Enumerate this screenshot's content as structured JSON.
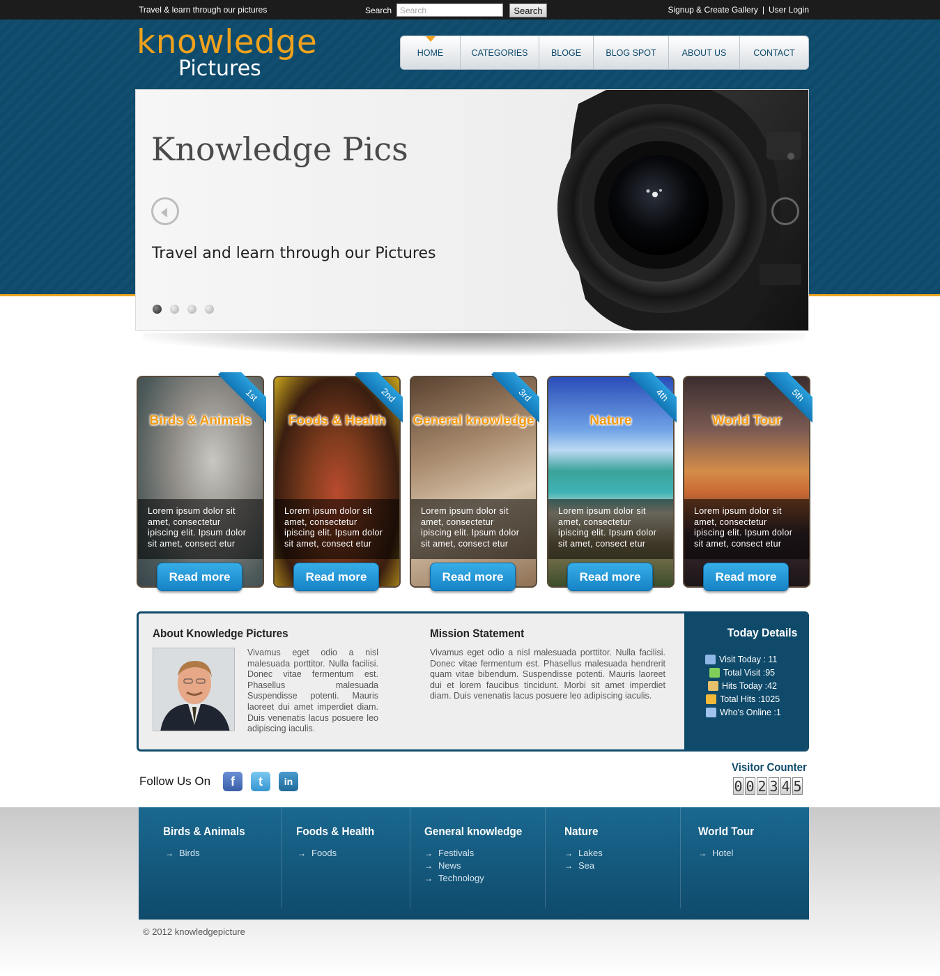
{
  "topbar": {
    "tagline": "Travel & learn through our pictures",
    "search_label": "Search",
    "search_placeholder": "Search",
    "search_button": "Search",
    "signup": "Signup & Create Gallery",
    "separator": "|",
    "login": "User Login"
  },
  "logo": {
    "line1": "knowledge",
    "line2": "Pictures"
  },
  "nav": {
    "items": [
      {
        "label": "HOME"
      },
      {
        "label": "CATEGORIES"
      },
      {
        "label": "BLOGE"
      },
      {
        "label": "BLOG SPOT"
      },
      {
        "label": "ABOUT US"
      },
      {
        "label": "CONTACT"
      }
    ],
    "active_index": 0
  },
  "slider": {
    "title": "Knowledge Pics",
    "subtitle": "Travel and learn through our Pictures",
    "slide_count": 4,
    "active_slide": 1
  },
  "cards": [
    {
      "rank": "1st",
      "title": "Birds & Animals",
      "text": "Lorem ipsum dolor sit amet, consectetur ipiscing elit. Ipsum dolor sit amet, consect etur",
      "button": "Read more"
    },
    {
      "rank": "2nd",
      "title": "Foods & Health",
      "text": "Lorem ipsum dolor sit amet, consectetur ipiscing elit. Ipsum dolor sit amet, consect etur",
      "button": "Read more"
    },
    {
      "rank": "3rd",
      "title": "General knowledge",
      "text": "Lorem ipsum dolor sit amet, consectetur ipiscing elit. Ipsum dolor sit amet, consect etur",
      "button": "Read more"
    },
    {
      "rank": "4th",
      "title": "Nature",
      "text": "Lorem ipsum dolor sit amet, consectetur ipiscing elit. Ipsum dolor sit amet, consect etur",
      "button": "Read more"
    },
    {
      "rank": "5th",
      "title": "World Tour",
      "text": "Lorem ipsum dolor sit amet, consectetur ipiscing elit. Ipsum dolor sit amet, consect etur",
      "button": "Read more"
    }
  ],
  "about": {
    "heading": "About Knowledge Pictures",
    "text": "Vivamus eget odio a nisl malesuada porttitor. Nulla facilisi. Donec vitae fermentum est. Phasellus malesuada Suspendisse potenti. Mauris laoreet dui amet imperdiet diam. Duis venenatis lacus posuere leo adipiscing iaculis."
  },
  "mission": {
    "heading": "Mission Statement",
    "text": "Vivamus eget odio a nisl malesuada porttitor. Nulla facilisi. Donec vitae fermentum est. Phasellus malesuada hendrerit quam vitae bibendum. Suspendisse potenti. Mauris laoreet dui et lorem faucibus tincidunt. Morbi sit amet imperdiet diam. Duis venenatis lacus posuere leo adipiscing iaculis."
  },
  "today": {
    "heading": "Today Details",
    "stats": [
      {
        "label": "Visit Today : 11",
        "icon": "users-icon",
        "color": "#8fb7e6"
      },
      {
        "label": "Total Visit :95",
        "icon": "mail-icon",
        "color": "#7fcf5a"
      },
      {
        "label": "Hits Today :42",
        "icon": "user-icon",
        "color": "#e6c06a"
      },
      {
        "label": "Total Hits :1025",
        "icon": "chart-icon",
        "color": "#f0b93a"
      },
      {
        "label": "Who's Online :1",
        "icon": "online-user-icon",
        "color": "#9fc3ee"
      }
    ]
  },
  "follow": {
    "label": "Follow Us On",
    "networks": [
      {
        "name": "facebook",
        "glyph": "f",
        "color": "#4a6fb5"
      },
      {
        "name": "twitter",
        "glyph": "t",
        "color": "#49a8dc"
      },
      {
        "name": "linkedin",
        "glyph": "in",
        "color": "#2a79aa"
      }
    ]
  },
  "visitor_counter": {
    "heading": "Visitor Counter",
    "digits": [
      "0",
      "0",
      "2",
      "3",
      "4",
      "5"
    ]
  },
  "footer": {
    "columns": [
      {
        "heading": "Birds & Animals",
        "links": [
          "Birds"
        ]
      },
      {
        "heading": "Foods & Health",
        "links": [
          "Foods"
        ]
      },
      {
        "heading": "General knowledge",
        "links": [
          "Festivals",
          "News",
          "Technology"
        ]
      },
      {
        "heading": "Nature",
        "links": [
          "Lakes",
          "Sea"
        ]
      },
      {
        "heading": "World Tour",
        "links": [
          "Hotel"
        ]
      }
    ],
    "copyright": "© 2012 knowledgepicture"
  },
  "colors": {
    "brand_blue": "#0f4a6b",
    "accent_orange": "#f0a21c",
    "button_blue": "#1e8fd2"
  }
}
